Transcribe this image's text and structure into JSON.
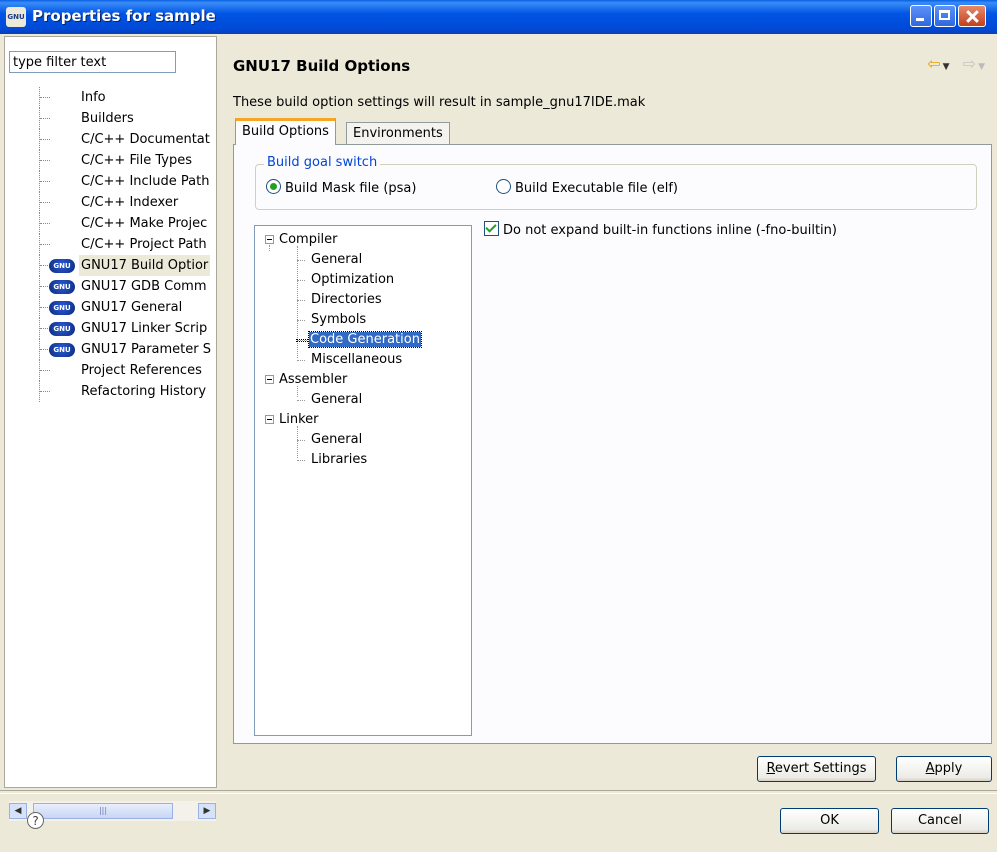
{
  "window": {
    "title": "Properties for sample",
    "app_icon_text": "GNU"
  },
  "left": {
    "filter_placeholder": "type filter text",
    "items": [
      {
        "label": "Info",
        "icon": "none"
      },
      {
        "label": "Builders",
        "icon": "none"
      },
      {
        "label": "C/C++ Documentat",
        "icon": "none"
      },
      {
        "label": "C/C++ File Types",
        "icon": "none"
      },
      {
        "label": "C/C++ Include Path",
        "icon": "none"
      },
      {
        "label": "C/C++ Indexer",
        "icon": "none"
      },
      {
        "label": "C/C++ Make Projec",
        "icon": "none"
      },
      {
        "label": "C/C++ Project Path",
        "icon": "none"
      },
      {
        "label": "GNU17 Build Optior",
        "icon": "gnu-icon",
        "selected": true
      },
      {
        "label": "GNU17 GDB Comm",
        "icon": "gnu-icon"
      },
      {
        "label": "GNU17 General",
        "icon": "gnu-icon"
      },
      {
        "label": "GNU17 Linker Scrip",
        "icon": "gnu-icon"
      },
      {
        "label": "GNU17 Parameter S",
        "icon": "gnu-icon"
      },
      {
        "label": "Project References",
        "icon": "none"
      },
      {
        "label": "Refactoring History",
        "icon": "none"
      }
    ],
    "scroll_thumb_glyph": "|||"
  },
  "main": {
    "title": "GNU17 Build Options",
    "description": "These build option settings will result in sample_gnu17IDE.mak",
    "tabs": [
      {
        "label": "Build Options",
        "active": true
      },
      {
        "label": "Environments",
        "active": false
      }
    ],
    "group": {
      "title": "Build goal switch",
      "radios": [
        {
          "label": "Build Mask file (psa)",
          "checked": true
        },
        {
          "label": "Build Executable file (elf)",
          "checked": false
        }
      ]
    },
    "tree": {
      "compiler": "Compiler",
      "compiler_children": [
        "General",
        "Optimization",
        "Directories",
        "Symbols",
        "Code Generation",
        "Miscellaneous"
      ],
      "selected": "Code Generation",
      "assembler": "Assembler",
      "assembler_children": [
        "General"
      ],
      "linker": "Linker",
      "linker_children": [
        "General",
        "Libraries"
      ]
    },
    "option": {
      "label": "Do not expand built-in functions inline (-fno-builtin)",
      "checked": true
    }
  },
  "buttons": {
    "revert": {
      "pre": "",
      "ul": "R",
      "post": "evert Settings"
    },
    "apply": {
      "pre": "",
      "ul": "A",
      "post": "pply"
    },
    "ok": "OK",
    "cancel": "Cancel"
  },
  "colors": {
    "titlebar": "#0055E5",
    "selection": "#316AC5",
    "tab_accent": "#F5A623",
    "group_title": "#0046D5"
  }
}
